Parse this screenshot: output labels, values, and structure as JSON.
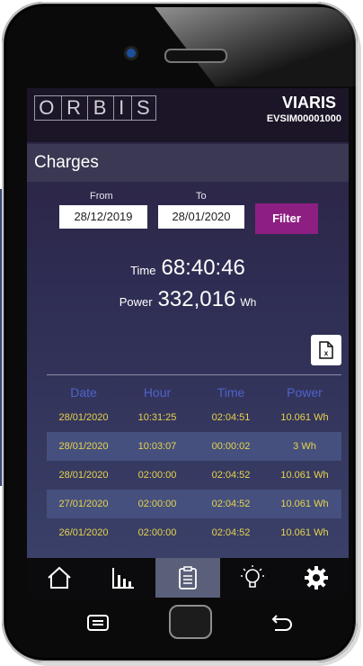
{
  "header": {
    "logo_letters": [
      "O",
      "R",
      "B",
      "I",
      "S"
    ],
    "brand": "VIARIS",
    "device_id": "EVSIM00001000"
  },
  "page": {
    "title": "Charges"
  },
  "filter": {
    "from_label": "From",
    "to_label": "To",
    "from_value": "28/12/2019",
    "to_value": "28/01/2020",
    "button_label": "Filter"
  },
  "summary": {
    "time_label": "Time",
    "time_value": "68:40:46",
    "power_label": "Power",
    "power_value": "332,016",
    "power_unit": "Wh"
  },
  "export": {
    "icon": "excel-export-icon",
    "glyph": "x"
  },
  "table": {
    "headers": [
      "Date",
      "Hour",
      "Time",
      "Power"
    ],
    "rows": [
      [
        "28/01/2020",
        "10:31:25",
        "02:04:51",
        "10.061 Wh"
      ],
      [
        "28/01/2020",
        "10:03:07",
        "00:00:02",
        "3 Wh"
      ],
      [
        "28/01/2020",
        "02:00:00",
        "02:04:52",
        "10.061 Wh"
      ],
      [
        "27/01/2020",
        "02:00:00",
        "02:04:52",
        "10.061 Wh"
      ],
      [
        "26/01/2020",
        "02:00:00",
        "02:04:52",
        "10.061 Wh"
      ]
    ]
  },
  "tabs": [
    {
      "icon": "home-icon",
      "active": false
    },
    {
      "icon": "bar-chart-icon",
      "active": false
    },
    {
      "icon": "clipboard-icon",
      "active": true
    },
    {
      "icon": "lightbulb-icon",
      "active": false
    },
    {
      "icon": "gear-icon",
      "active": false
    }
  ],
  "colors": {
    "accent": "#8d1f82",
    "table_text": "#e7d34d",
    "table_header": "#4d63c9",
    "header_bg": "#1b1527"
  }
}
